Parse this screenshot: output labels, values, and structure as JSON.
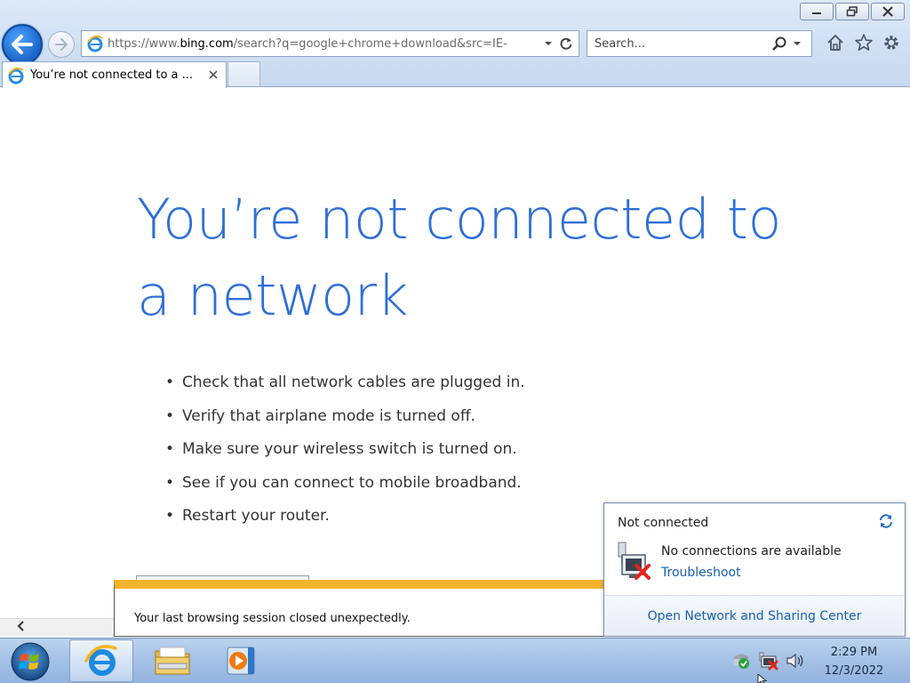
{
  "browser": {
    "address_bar": {
      "url_prefix": "https://www.",
      "url_domain": "bing.com",
      "url_rest": "/search?q=google+chrome+download&src=IE-"
    },
    "search_box": {
      "placeholder": "Search..."
    },
    "tab": {
      "title": "You’re not connected to a ..."
    }
  },
  "page": {
    "heading": "You’re not connected to a network",
    "tips": [
      "Check that all network cables are plugged in.",
      "Verify that airplane mode is turned off.",
      "Make sure your wireless switch is turned on.",
      "See if you can connect to mobile broadband.",
      "Restart your router."
    ]
  },
  "notification_bar": {
    "message": "Your last browsing session closed unexpectedly."
  },
  "network_flyout": {
    "title": "Not connected",
    "message": "No connections are available",
    "troubleshoot_link": "Troubleshoot",
    "open_center_link": "Open Network and Sharing Center"
  },
  "taskbar": {
    "clock": {
      "time": "2:29 PM",
      "date": "12/3/2022"
    },
    "icons": [
      "start-orb-icon",
      "internet-explorer-icon",
      "file-explorer-icon",
      "media-player-icon",
      "action-center-icon",
      "network-disconnected-icon",
      "volume-icon"
    ]
  },
  "colors": {
    "heading_blue": "#2f6fd7",
    "link_blue": "#1a5fb4",
    "notify_accent": "#f0b32b"
  }
}
